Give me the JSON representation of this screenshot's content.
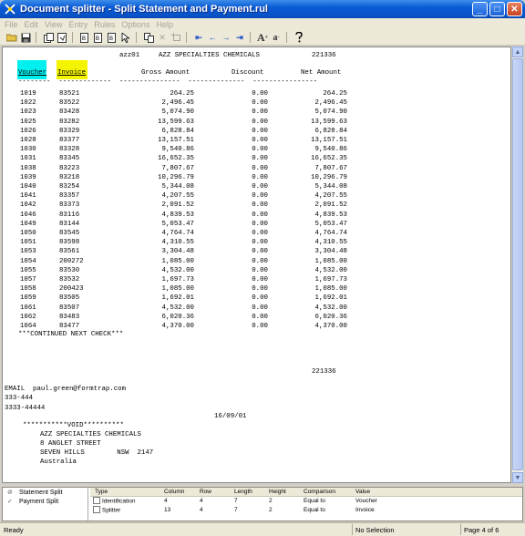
{
  "window": {
    "title": "Document splitter - Split Statement and Payment.rul"
  },
  "menu": [
    "File",
    "Edit",
    "View",
    "Entry",
    "Rules",
    "Options",
    "Help"
  ],
  "toolbar": {
    "icons": [
      "folder-open-icon",
      "save-icon",
      "separator",
      "copy-doc-icon",
      "copy-doc-icon",
      "separator",
      "page-icon",
      "page-icon",
      "page-icon",
      "cursor-icon",
      "separator",
      "copy-icon",
      "delete-icon",
      "crop-icon",
      "separator",
      "first-page-icon",
      "prev-page-icon",
      "next-page-icon",
      "last-page-icon",
      "separator",
      "font-larger-icon",
      "font-smaller-icon",
      "separator",
      "help-icon"
    ]
  },
  "document": {
    "header_code": "azz01",
    "company_name": "AZZ SPECIALTIES CHEMICALS",
    "account_number": "221336",
    "columns": {
      "voucher": "Voucher",
      "invoice": "Invoice",
      "gross": "Gross Amount",
      "discount": "Discount",
      "net": "Net Amount"
    },
    "rows": [
      [
        "1019",
        "83521",
        "264.25",
        "0.00",
        "264.25"
      ],
      [
        "1022",
        "83522",
        "2,496.45",
        "0.00",
        "2,496.45"
      ],
      [
        "1023",
        "83428",
        "5,074.90",
        "0.00",
        "5,074.90"
      ],
      [
        "1025",
        "83282",
        "13,599.63",
        "0.00",
        "13,599.63"
      ],
      [
        "1026",
        "83329",
        "6,828.84",
        "0.00",
        "6,828.84"
      ],
      [
        "1028",
        "83377",
        "13,157.51",
        "0.00",
        "13,157.51"
      ],
      [
        "1030",
        "83328",
        "9,540.86",
        "0.00",
        "9,540.86"
      ],
      [
        "1031",
        "83345",
        "16,652.35",
        "0.00",
        "16,652.35"
      ],
      [
        "1038",
        "83223",
        "7,807.67",
        "0.00",
        "7,807.67"
      ],
      [
        "1039",
        "83218",
        "10,296.79",
        "0.00",
        "10,296.79"
      ],
      [
        "1040",
        "83254",
        "5,344.08",
        "0.00",
        "5,344.08"
      ],
      [
        "1041",
        "83357",
        "4,207.55",
        "0.00",
        "4,207.55"
      ],
      [
        "1042",
        "83373",
        "2,091.52",
        "0.00",
        "2,091.52"
      ],
      [
        "1046",
        "83116",
        "4,839.53",
        "0.00",
        "4,839.53"
      ],
      [
        "1049",
        "83144",
        "5,053.47",
        "0.00",
        "5,053.47"
      ],
      [
        "1050",
        "83545",
        "4,764.74",
        "0.00",
        "4,764.74"
      ],
      [
        "1051",
        "83598",
        "4,310.55",
        "0.00",
        "4,310.55"
      ],
      [
        "1053",
        "83561",
        "3,304.48",
        "0.00",
        "3,304.48"
      ],
      [
        "1054",
        "200272",
        "1,085.00",
        "0.00",
        "1,085.00"
      ],
      [
        "1055",
        "83530",
        "4,532.00",
        "0.00",
        "4,532.00"
      ],
      [
        "1057",
        "83532",
        "1,697.73",
        "0.00",
        "1,697.73"
      ],
      [
        "1058",
        "200423",
        "1,085.00",
        "0.00",
        "1,085.00"
      ],
      [
        "1059",
        "83505",
        "1,692.01",
        "0.00",
        "1,692.01"
      ],
      [
        "1061",
        "83507",
        "4,532.00",
        "0.00",
        "4,532.00"
      ],
      [
        "1062",
        "83483",
        "6,020.36",
        "0.00",
        "6,020.36"
      ],
      [
        "1064",
        "83477",
        "4,370.00",
        "0.00",
        "4,370.00"
      ]
    ],
    "continued_note": "***CONTINUED NEXT CHECK***",
    "footer_account": "221336",
    "email_line": "EMAIL  paul.green@formtrap.com",
    "phone1": "333-444",
    "phone2": "3333-44444",
    "date": "16/09/01",
    "void_line": "***********VOID**********",
    "address": [
      "AZZ SPECIALTIES CHEMICALS",
      "8 ANGLET STREET",
      "SEVEN HILLS        NSW  2147",
      "Australia"
    ]
  },
  "splits": [
    {
      "label": "Statement Split",
      "checked": false
    },
    {
      "label": "Payment Split",
      "checked": true
    }
  ],
  "rules_grid": {
    "headers": [
      "Type",
      "Column",
      "Row",
      "Length",
      "Height",
      "Comparison",
      "Value"
    ],
    "rows": [
      [
        "Identification",
        "4",
        "4",
        "7",
        "2",
        "Equal to",
        "Voucher"
      ],
      [
        "Splitter",
        "13",
        "4",
        "7",
        "2",
        "Equal to",
        "Invoice"
      ]
    ]
  },
  "status": {
    "ready": "Ready",
    "selection": "No Selection",
    "page": "Page 4 of 6"
  }
}
